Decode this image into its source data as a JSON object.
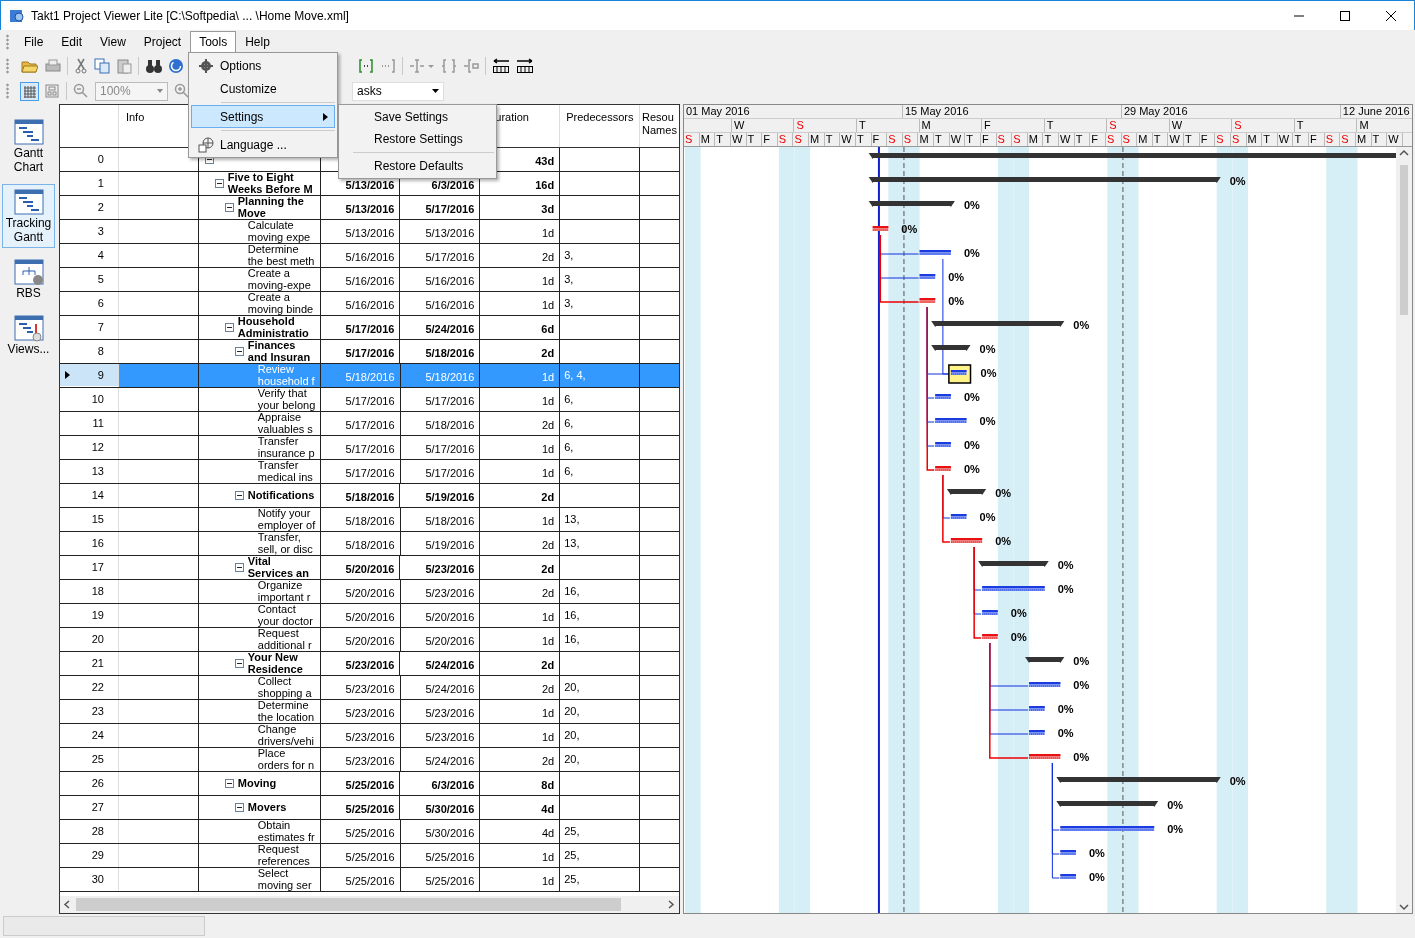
{
  "window": {
    "title": "Takt1 Project Viewer Lite [C:\\Softpedia\\ ... \\Home Move.xml]"
  },
  "menu_bar": [
    {
      "label": "File",
      "selected": false
    },
    {
      "label": "Edit",
      "selected": false
    },
    {
      "label": "View",
      "selected": false
    },
    {
      "label": "Project",
      "selected": false
    },
    {
      "label": "Tools",
      "selected": true
    },
    {
      "label": "Help",
      "selected": false
    }
  ],
  "tools_menu": [
    {
      "kind": "item",
      "label": "Options",
      "selected": false
    },
    {
      "kind": "item",
      "label": "Customize",
      "selected": false
    },
    {
      "kind": "separator"
    },
    {
      "kind": "submenu",
      "label": "Settings",
      "selected": true
    },
    {
      "kind": "separator"
    },
    {
      "kind": "item",
      "label": "Language ...",
      "selected": false
    }
  ],
  "settings_submenu": [
    {
      "kind": "item",
      "label": "Save Settings"
    },
    {
      "kind": "item",
      "label": "Restore Settings"
    },
    {
      "kind": "separator"
    },
    {
      "kind": "item",
      "label": "Restore Defaults"
    }
  ],
  "toolbar": {
    "zoom": "100%",
    "filter": "asks"
  },
  "views": [
    {
      "kind": "gantt",
      "label": "Gantt Chart",
      "selected": false
    },
    {
      "kind": "tracking",
      "label": "Tracking Gantt",
      "selected": true
    },
    {
      "kind": "rbs",
      "label": "RBS",
      "selected": false
    },
    {
      "kind": "views",
      "label": "Views...",
      "selected": false
    }
  ],
  "table": {
    "header": {
      "info": "Info",
      "duration": "uration",
      "predecessors": "Predecessors",
      "resources": "Resou\nNames"
    },
    "rows": [
      {
        "id": "0",
        "duration": "43d",
        "expanded": true,
        "selected": false,
        "children": [
          {
            "id": "1",
            "name": "Five to Eight\nWeeks Before M",
            "start": "5/13/2016",
            "finish": "6/3/2016",
            "duration": "16d",
            "progress": "0%",
            "expanded": true,
            "selected": false,
            "children": [
              {
                "id": "2",
                "name": "Planning the\nMove",
                "start": "5/13/2016",
                "finish": "5/17/2016",
                "duration": "3d",
                "progress": "0%",
                "expanded": true,
                "selected": false,
                "children": [
                  {
                    "id": "3",
                    "name": "Calculate\nmoving expe",
                    "start": "5/13/2016",
                    "finish": "5/13/2016",
                    "duration": "1d",
                    "progress": "0%",
                    "critical": true,
                    "selected": false
                  },
                  {
                    "id": "4",
                    "name": "Determine\nthe best meth",
                    "start": "5/16/2016",
                    "finish": "5/17/2016",
                    "duration": "2d",
                    "predecessors": "3,",
                    "progress": "0%",
                    "critical": false,
                    "selected": false
                  },
                  {
                    "id": "5",
                    "name": "Create a\nmoving-expe",
                    "start": "5/16/2016",
                    "finish": "5/16/2016",
                    "duration": "1d",
                    "predecessors": "3,",
                    "progress": "0%",
                    "critical": false,
                    "selected": false
                  },
                  {
                    "id": "6",
                    "name": "Create a\nmoving binde",
                    "start": "5/16/2016",
                    "finish": "5/16/2016",
                    "duration": "1d",
                    "predecessors": "3,",
                    "progress": "0%",
                    "critical": true,
                    "selected": false
                  }
                ]
              },
              {
                "id": "7",
                "name": "Household\nAdministratio",
                "start": "5/17/2016",
                "finish": "5/24/2016",
                "duration": "6d",
                "progress": "0%",
                "expanded": true,
                "selected": false,
                "children": [
                  {
                    "id": "8",
                    "name": "Finances\nand Insuran",
                    "start": "5/17/2016",
                    "finish": "5/18/2016",
                    "duration": "2d",
                    "progress": "0%",
                    "expanded": true,
                    "selected": false,
                    "children": [
                      {
                        "id": "9",
                        "name": "Review\nhousehold f",
                        "start": "5/18/2016",
                        "finish": "5/18/2016",
                        "duration": "1d",
                        "predecessors": "6, 4,",
                        "progress": "0%",
                        "critical": false,
                        "selected": true
                      },
                      {
                        "id": "10",
                        "name": "Verify that\nyour belong",
                        "start": "5/17/2016",
                        "finish": "5/17/2016",
                        "duration": "1d",
                        "predecessors": "6,",
                        "progress": "0%",
                        "critical": false,
                        "selected": false
                      },
                      {
                        "id": "11",
                        "name": "Appraise\nvaluables s",
                        "start": "5/17/2016",
                        "finish": "5/18/2016",
                        "duration": "2d",
                        "predecessors": "6,",
                        "progress": "0%",
                        "critical": false,
                        "selected": false
                      },
                      {
                        "id": "12",
                        "name": "Transfer\ninsurance p",
                        "start": "5/17/2016",
                        "finish": "5/17/2016",
                        "duration": "1d",
                        "predecessors": "6,",
                        "progress": "0%",
                        "critical": false,
                        "selected": false
                      },
                      {
                        "id": "13",
                        "name": "Transfer\nmedical ins",
                        "start": "5/17/2016",
                        "finish": "5/17/2016",
                        "duration": "1d",
                        "predecessors": "6,",
                        "progress": "0%",
                        "critical": true,
                        "selected": false
                      }
                    ]
                  },
                  {
                    "id": "14",
                    "name": "Notifications",
                    "start": "5/18/2016",
                    "finish": "5/19/2016",
                    "duration": "2d",
                    "progress": "0%",
                    "expanded": true,
                    "selected": false,
                    "children": [
                      {
                        "id": "15",
                        "name": "Notify your\nemployer of",
                        "start": "5/18/2016",
                        "finish": "5/18/2016",
                        "duration": "1d",
                        "predecessors": "13,",
                        "progress": "0%",
                        "critical": false,
                        "selected": false
                      },
                      {
                        "id": "16",
                        "name": "Transfer,\nsell, or disc",
                        "start": "5/18/2016",
                        "finish": "5/19/2016",
                        "duration": "2d",
                        "predecessors": "13,",
                        "progress": "0%",
                        "critical": true,
                        "selected": false
                      }
                    ]
                  },
                  {
                    "id": "17",
                    "name": "Vital\nServices an",
                    "start": "5/20/2016",
                    "finish": "5/23/2016",
                    "duration": "2d",
                    "progress": "0%",
                    "expanded": true,
                    "selected": false,
                    "children": [
                      {
                        "id": "18",
                        "name": "Organize\nimportant r",
                        "start": "5/20/2016",
                        "finish": "5/23/2016",
                        "duration": "2d",
                        "predecessors": "16,",
                        "progress": "0%",
                        "critical": false,
                        "selected": false
                      },
                      {
                        "id": "19",
                        "name": "Contact\nyour doctor",
                        "start": "5/20/2016",
                        "finish": "5/20/2016",
                        "duration": "1d",
                        "predecessors": "16,",
                        "progress": "0%",
                        "critical": false,
                        "selected": false
                      },
                      {
                        "id": "20",
                        "name": "Request\nadditional r",
                        "start": "5/20/2016",
                        "finish": "5/20/2016",
                        "duration": "1d",
                        "predecessors": "16,",
                        "progress": "0%",
                        "critical": true,
                        "selected": false
                      }
                    ]
                  },
                  {
                    "id": "21",
                    "name": "Your New\nResidence",
                    "start": "5/23/2016",
                    "finish": "5/24/2016",
                    "duration": "2d",
                    "progress": "0%",
                    "expanded": true,
                    "selected": false,
                    "children": [
                      {
                        "id": "22",
                        "name": "Collect\nshopping a",
                        "start": "5/23/2016",
                        "finish": "5/24/2016",
                        "duration": "2d",
                        "predecessors": "20,",
                        "progress": "0%",
                        "critical": false,
                        "selected": false
                      },
                      {
                        "id": "23",
                        "name": "Determine\nthe location",
                        "start": "5/23/2016",
                        "finish": "5/23/2016",
                        "duration": "1d",
                        "predecessors": "20,",
                        "progress": "0%",
                        "critical": false,
                        "selected": false
                      },
                      {
                        "id": "24",
                        "name": "Change\ndrivers/vehi",
                        "start": "5/23/2016",
                        "finish": "5/23/2016",
                        "duration": "1d",
                        "predecessors": "20,",
                        "progress": "0%",
                        "critical": false,
                        "selected": false
                      },
                      {
                        "id": "25",
                        "name": "Place\norders for n",
                        "start": "5/23/2016",
                        "finish": "5/24/2016",
                        "duration": "2d",
                        "predecessors": "20,",
                        "progress": "0%",
                        "critical": true,
                        "selected": false
                      }
                    ]
                  }
                ]
              },
              {
                "id": "26",
                "name": "Moving",
                "start": "5/25/2016",
                "finish": "6/3/2016",
                "duration": "8d",
                "progress": "0%",
                "expanded": true,
                "selected": false,
                "children": [
                  {
                    "id": "27",
                    "name": "Movers",
                    "start": "5/25/2016",
                    "finish": "5/30/2016",
                    "duration": "4d",
                    "progress": "0%",
                    "expanded": true,
                    "selected": false,
                    "children": [
                      {
                        "id": "28",
                        "name": "Obtain\nestimates fr",
                        "start": "5/25/2016",
                        "finish": "5/30/2016",
                        "duration": "4d",
                        "predecessors": "25,",
                        "progress": "0%",
                        "critical": false,
                        "selected": false
                      },
                      {
                        "id": "29",
                        "name": "Request\nreferences",
                        "start": "5/25/2016",
                        "finish": "5/25/2016",
                        "duration": "1d",
                        "predecessors": "25,",
                        "progress": "0%",
                        "critical": false,
                        "selected": false
                      },
                      {
                        "id": "30",
                        "name": "Select\nmoving ser",
                        "start": "5/25/2016",
                        "finish": "5/25/2016",
                        "duration": "1d",
                        "predecessors": "25,",
                        "progress": "0%",
                        "critical": false,
                        "selected": false
                      }
                    ]
                  }
                ]
              }
            ]
          }
        ]
      }
    ]
  },
  "gantt": {
    "months": [
      "01 May 2016",
      "15 May 2016",
      "29 May 2016",
      "12 June 2016"
    ],
    "weeks": [
      {
        "label": "W",
        "weekend": false
      },
      {
        "label": "S",
        "weekend": true
      },
      {
        "label": "T",
        "weekend": false
      },
      {
        "label": "M",
        "weekend": false
      },
      {
        "label": "F",
        "weekend": false
      },
      {
        "label": "T",
        "weekend": false
      },
      {
        "label": "S",
        "weekend": true
      },
      {
        "label": "W",
        "weekend": false
      },
      {
        "label": "S",
        "weekend": true
      },
      {
        "label": "T",
        "weekend": false
      },
      {
        "label": "M",
        "weekend": false
      }
    ],
    "days": [
      {
        "label": "S",
        "weekend": true
      },
      {
        "label": "M",
        "weekend": false
      },
      {
        "label": "T",
        "weekend": false
      },
      {
        "label": "W",
        "weekend": false
      },
      {
        "label": "T",
        "weekend": false
      },
      {
        "label": "F",
        "weekend": false
      },
      {
        "label": "S",
        "weekend": true
      },
      {
        "label": "S",
        "weekend": true
      },
      {
        "label": "M",
        "weekend": false
      },
      {
        "label": "T",
        "weekend": false
      },
      {
        "label": "W",
        "weekend": false
      },
      {
        "label": "T",
        "weekend": false
      },
      {
        "label": "F",
        "weekend": false
      },
      {
        "label": "S",
        "weekend": true
      },
      {
        "label": "S",
        "weekend": true
      },
      {
        "label": "M",
        "weekend": false
      },
      {
        "label": "T",
        "weekend": false
      },
      {
        "label": "W",
        "weekend": false
      },
      {
        "label": "T",
        "weekend": false
      },
      {
        "label": "F",
        "weekend": false
      },
      {
        "label": "S",
        "weekend": true
      },
      {
        "label": "S",
        "weekend": true
      },
      {
        "label": "M",
        "weekend": false
      },
      {
        "label": "T",
        "weekend": false
      },
      {
        "label": "W",
        "weekend": false
      },
      {
        "label": "T",
        "weekend": false
      },
      {
        "label": "F",
        "weekend": false
      },
      {
        "label": "S",
        "weekend": true
      },
      {
        "label": "S",
        "weekend": true
      },
      {
        "label": "M",
        "weekend": false
      },
      {
        "label": "T",
        "weekend": false
      },
      {
        "label": "W",
        "weekend": false
      },
      {
        "label": "T",
        "weekend": false
      },
      {
        "label": "F",
        "weekend": false
      },
      {
        "label": "S",
        "weekend": true
      },
      {
        "label": "S",
        "weekend": true
      },
      {
        "label": "M",
        "weekend": false
      },
      {
        "label": "T",
        "weekend": false
      },
      {
        "label": "W",
        "weekend": false
      },
      {
        "label": "T",
        "weekend": false
      },
      {
        "label": "F",
        "weekend": false
      },
      {
        "label": "S",
        "weekend": true
      },
      {
        "label": "S",
        "weekend": true
      },
      {
        "label": "M",
        "weekend": false
      },
      {
        "label": "T",
        "weekend": false
      },
      {
        "label": "W",
        "weekend": false
      }
    ]
  }
}
